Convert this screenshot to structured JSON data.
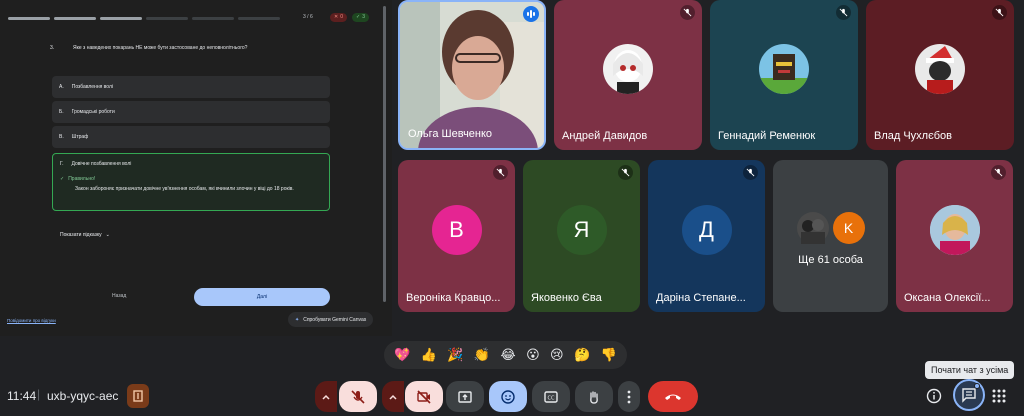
{
  "quiz": {
    "counter": "3 / 6",
    "wrong_count": "0",
    "right_count": "3",
    "question_number": "3.",
    "question_text": "Яке з наведених покарань НЕ може бути застосоване до неповнолітнього?",
    "options": [
      {
        "letter": "А.",
        "text": "Позбавлення волі"
      },
      {
        "letter": "Б.",
        "text": "Громадські роботи"
      },
      {
        "letter": "В.",
        "text": "Штраф"
      },
      {
        "letter": "Г.",
        "text": "Довічне позбавлення волі"
      }
    ],
    "correct_label": "Правильно!",
    "explanation": "Закон забороняє призначати довічне ув'язнення особам, які вчинили злочин у віці до 18 років.",
    "hint_label": "Показати підказку",
    "back_label": "Назад",
    "next_label": "Далі",
    "feedback_link": "Повідомити про відгуки",
    "gemini_label": "Спробувати Gemini Canvas"
  },
  "participants": [
    {
      "name": "Ольга Шевченко"
    },
    {
      "name": "Андрей Давидов"
    },
    {
      "name": "Геннадий Ременюк"
    },
    {
      "name": "Влад Чухлєбов"
    },
    {
      "name": "Вероніка Кравцо...",
      "initial": "В"
    },
    {
      "name": "Яковенко Єва",
      "initial": "Я"
    },
    {
      "name": "Даріна Степане...",
      "initial": "Д"
    },
    {
      "name": "Ще 61 особа",
      "initial": "K"
    },
    {
      "name": "Оксана Олексії..."
    }
  ],
  "reactions": [
    "💖",
    "👍",
    "🎉",
    "👏",
    "😂",
    "😮",
    "😢",
    "🤔",
    "👎"
  ],
  "bottom": {
    "time": "11:44",
    "separator": "|",
    "meeting_code": "uxb-yqyc-aec",
    "chat_tooltip": "Почати чат з усіма"
  },
  "colors": {
    "accent": "#8ab4f8",
    "end_call": "#dc362e",
    "tile_pink": "#7d3145",
    "tile_teal": "#1c4451",
    "tile_maroon": "#5c1d24",
    "tile_green": "#2d4a24",
    "tile_blue": "#14365c"
  }
}
